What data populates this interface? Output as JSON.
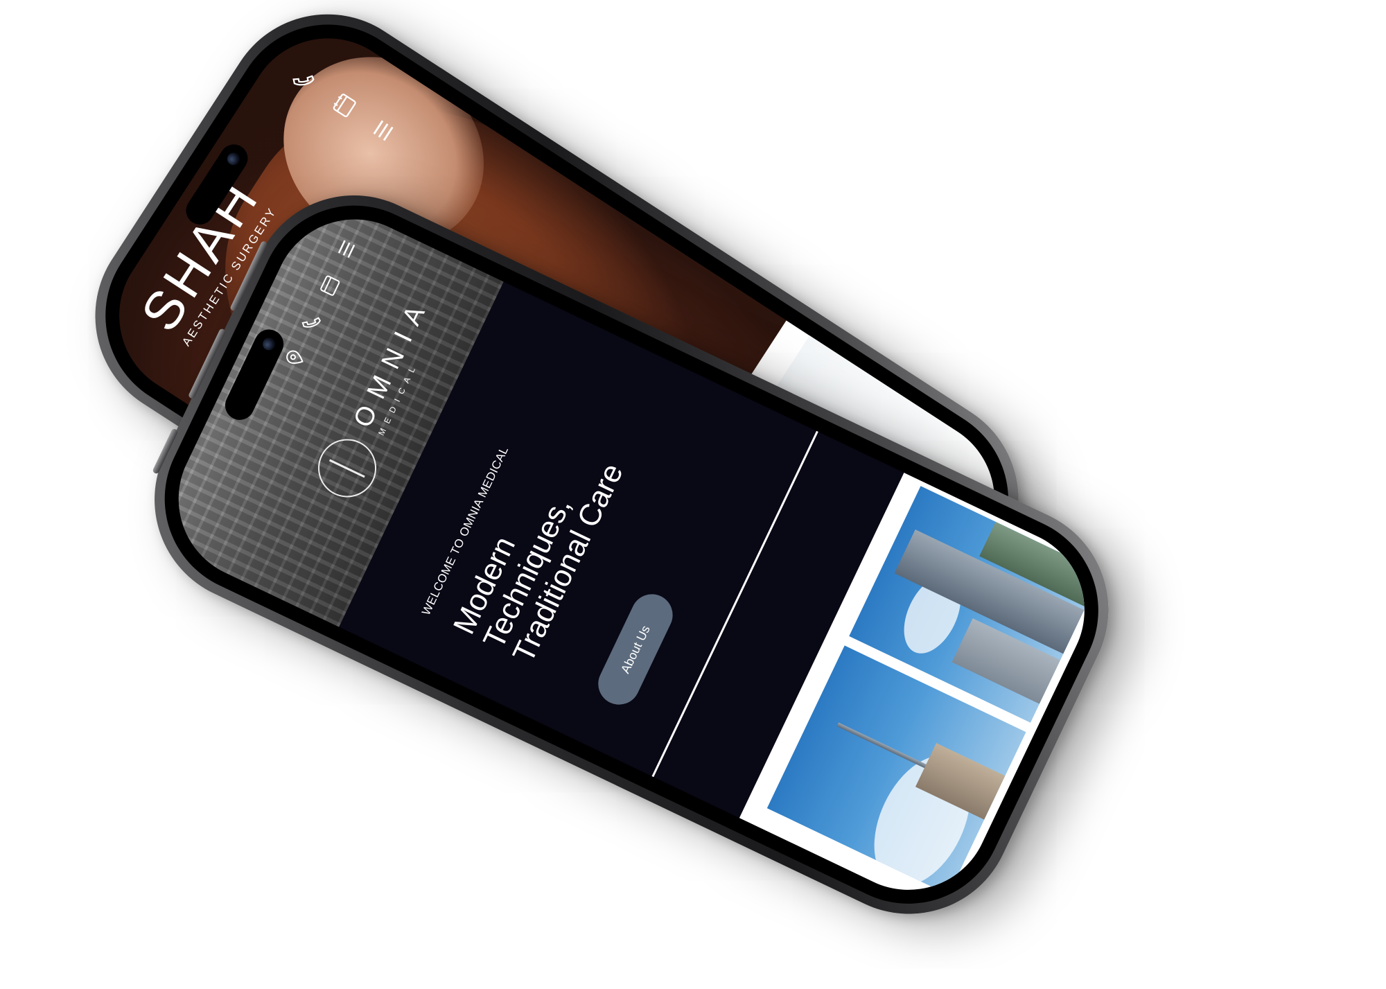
{
  "back_phone": {
    "brand": "SHAH",
    "brand_sub": "AESTHETIC SURGERY",
    "icons": [
      "phone-icon",
      "calendar-icon",
      "menu-icon"
    ]
  },
  "front_phone": {
    "logo_name": "OMNIA",
    "logo_sub": "MEDICAL",
    "welcome": "WELCOME TO OMNIA MEDICAL",
    "headline_lines": [
      "Modern",
      "Techniques,",
      "Traditional Care"
    ],
    "cta_label": "About Us",
    "icons": [
      "menu-icon",
      "calendar-icon",
      "phone-icon",
      "location-icon"
    ]
  },
  "colors": {
    "omnia_dark_bg": "#090815",
    "cta_bg": "#5c6b7d",
    "phone_frame": "#2b2b2d"
  }
}
